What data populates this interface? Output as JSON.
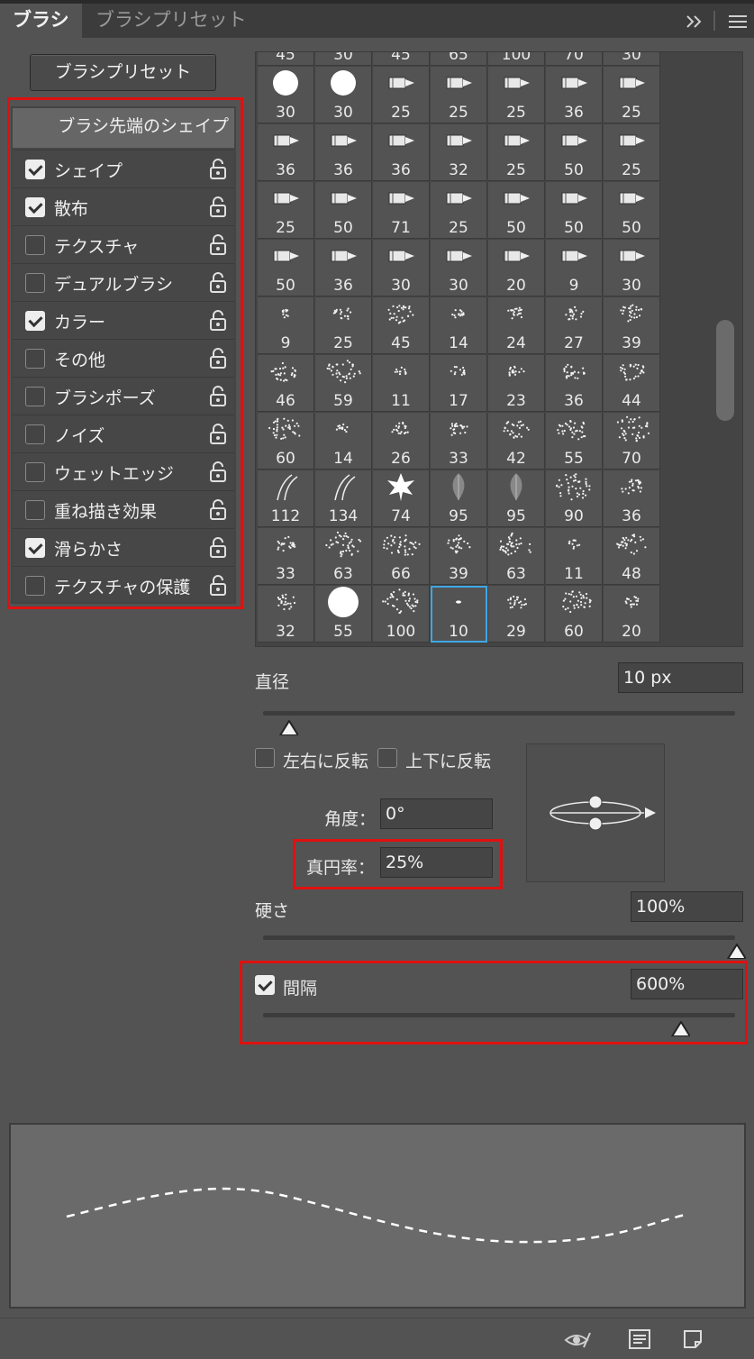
{
  "tabs": {
    "brush": "ブラシ",
    "brush_preset": "ブラシプリセット"
  },
  "preset_button": "ブラシプリセット",
  "list": {
    "header": "ブラシ先端のシェイプ",
    "items": [
      {
        "label": "シェイプ",
        "checked": true
      },
      {
        "label": "散布",
        "checked": true
      },
      {
        "label": "テクスチャ",
        "checked": false
      },
      {
        "label": "デュアルブラシ",
        "checked": false
      },
      {
        "label": "カラー",
        "checked": true
      },
      {
        "label": "その他",
        "checked": false
      },
      {
        "label": "ブラシポーズ",
        "checked": false
      },
      {
        "label": "ノイズ",
        "checked": false
      },
      {
        "label": "ウェットエッジ",
        "checked": false
      },
      {
        "label": "重ね描き効果",
        "checked": false
      },
      {
        "label": "滑らかさ",
        "checked": true
      },
      {
        "label": "テクスチャの保護",
        "checked": false
      }
    ]
  },
  "brush_grid": {
    "top_partial_row": [
      "45",
      "30",
      "45",
      "65",
      "100",
      "70",
      "30"
    ],
    "rows": [
      [
        "30",
        "30",
        "25",
        "25",
        "25",
        "36",
        "25"
      ],
      [
        "36",
        "36",
        "36",
        "32",
        "25",
        "50",
        "25"
      ],
      [
        "25",
        "50",
        "71",
        "25",
        "50",
        "50",
        "50"
      ],
      [
        "50",
        "36",
        "30",
        "30",
        "20",
        "9",
        "30"
      ],
      [
        "9",
        "25",
        "45",
        "14",
        "24",
        "27",
        "39"
      ],
      [
        "46",
        "59",
        "11",
        "17",
        "23",
        "36",
        "44"
      ],
      [
        "60",
        "14",
        "26",
        "33",
        "42",
        "55",
        "70"
      ],
      [
        "112",
        "134",
        "74",
        "95",
        "95",
        "90",
        "36"
      ],
      [
        "33",
        "63",
        "66",
        "39",
        "63",
        "11",
        "48"
      ],
      [
        "32",
        "55",
        "100",
        "10",
        "29",
        "60",
        "20"
      ]
    ],
    "selected": "10"
  },
  "diameter": {
    "label": "直径",
    "value": "10 px",
    "fraction": 0.04
  },
  "flip_x": {
    "label": "左右に反転",
    "checked": false
  },
  "flip_y": {
    "label": "上下に反転",
    "checked": false
  },
  "angle": {
    "label": "角度：",
    "value": "0°"
  },
  "roundness": {
    "label": "真円率：",
    "value": "25%"
  },
  "hardness": {
    "label": "硬さ",
    "value": "100%",
    "fraction": 1.0
  },
  "spacing": {
    "label": "間隔",
    "value": "600%",
    "checked": true,
    "fraction": 0.87
  },
  "colors": {
    "highlight": "#e01010",
    "selection": "#3ea7e6"
  },
  "icons": {
    "bottom": [
      "eye-brush-icon",
      "brush-settings-icon",
      "new-brush-icon"
    ]
  }
}
